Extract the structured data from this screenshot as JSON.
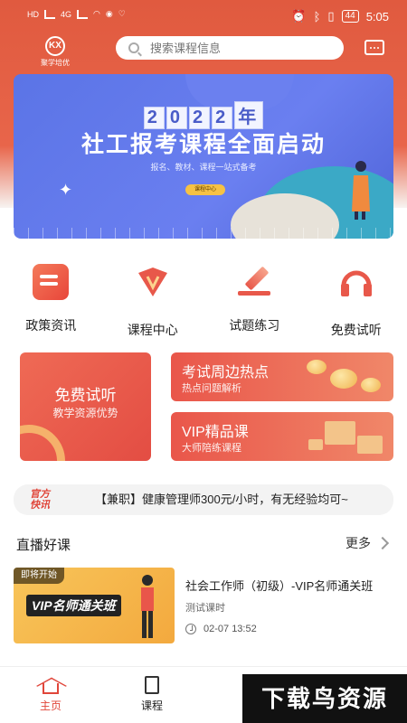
{
  "status_bar": {
    "left_items": [
      "HD",
      "5G",
      "4G",
      "wifi",
      "chat",
      "heart"
    ],
    "battery": "44",
    "time": "5:05",
    "icons": [
      "alarm-icon",
      "bluetooth-icon",
      "vibrate-icon"
    ]
  },
  "header": {
    "logo_text": "聚学培优",
    "logo_mark": "KX",
    "search_placeholder": "搜索课程信息",
    "message_icon": "message-icon"
  },
  "banner": {
    "year_chars": [
      "2",
      "0",
      "2",
      "2",
      "年"
    ],
    "title": "社工报考课程全面启动",
    "subtitle": "报名、教材、课程一站式备考",
    "button_label": "课程中心"
  },
  "quick_menu": [
    {
      "label": "政策资讯",
      "icon": "news-icon"
    },
    {
      "label": "课程中心",
      "icon": "course-icon"
    },
    {
      "label": "试题练习",
      "icon": "pen-icon"
    },
    {
      "label": "免费试听",
      "icon": "headphones-icon"
    }
  ],
  "promo": {
    "free": {
      "title": "免费试听",
      "subtitle": "教学资源优势"
    },
    "hot": {
      "title": "考试周边热点",
      "subtitle": "热点问题解析"
    },
    "vip": {
      "title": "VIP精品课",
      "subtitle": "大师陪练课程"
    }
  },
  "ticker": {
    "tag_line1": "官方",
    "tag_line2": "快讯",
    "text": "【兼职】健康管理师300元/小时，有无经验均可~"
  },
  "live_section": {
    "title": "直播好课",
    "more_label": "更多",
    "course": {
      "badge": "即将开始",
      "thumb_text": "VIP名师通关班",
      "name": "社会工作师（初级）-VIP名师通关班",
      "sub": "测试课时",
      "time": "02-07 13:52"
    }
  },
  "bottom_nav": [
    {
      "label": "主页",
      "active": true
    },
    {
      "label": "课程",
      "active": false
    }
  ],
  "watermark": "下载鸟资源",
  "colors": {
    "brand": "#e0463a",
    "banner": "#5b74e6",
    "gold": "#f3a93e"
  }
}
